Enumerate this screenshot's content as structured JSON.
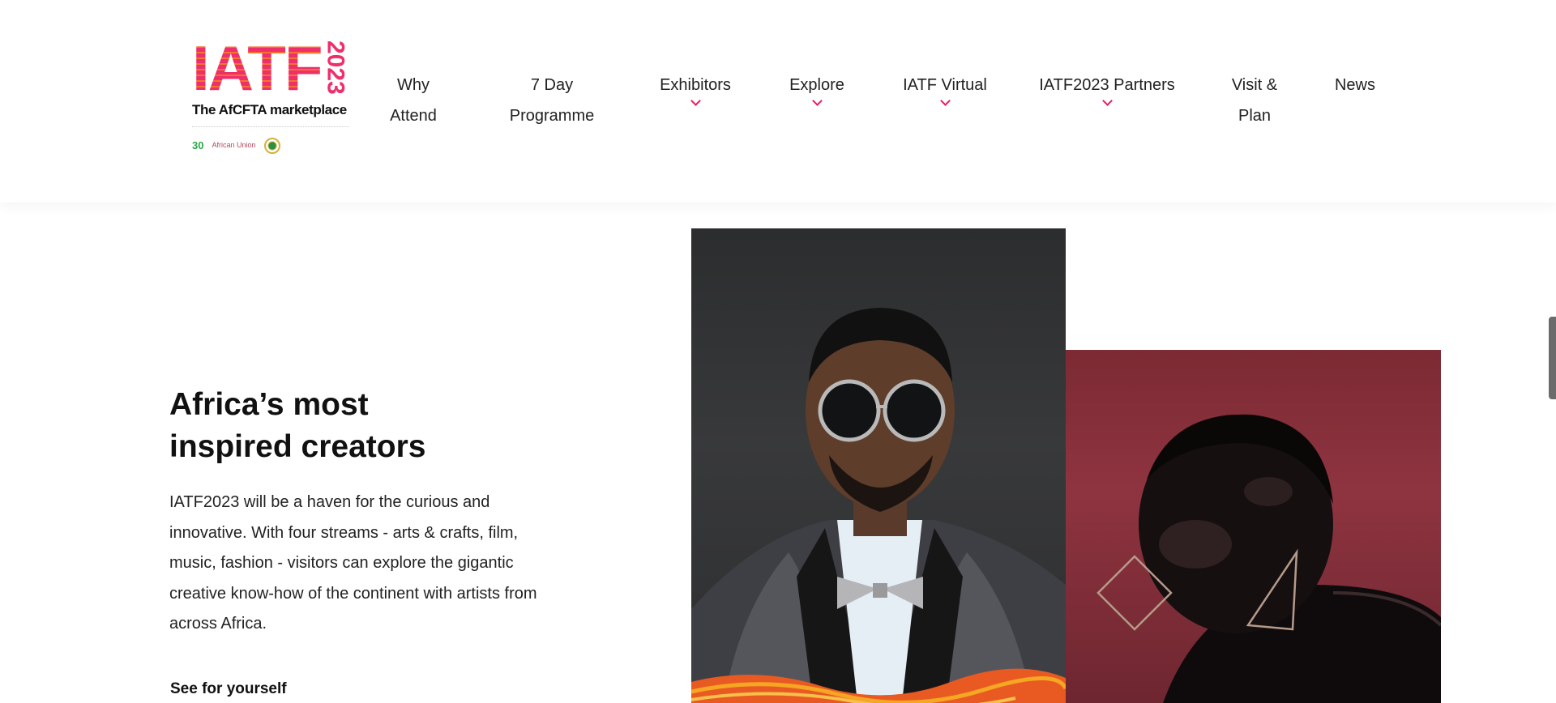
{
  "logo": {
    "main_text": "IATF",
    "year": "2023",
    "tagline": "The AfCFTA marketplace",
    "partners": [
      "30",
      "African Union",
      "seal"
    ]
  },
  "nav": {
    "items": [
      {
        "label": "Why\nAttend"
      },
      {
        "label": "7 Day\nProgramme"
      },
      {
        "label": "Exhibitors"
      },
      {
        "label": "Explore"
      },
      {
        "label": "IATF Virtual"
      },
      {
        "label": "IATF2023 Partners"
      },
      {
        "label": "Visit &\nPlan"
      },
      {
        "label": "News"
      }
    ]
  },
  "hero": {
    "title": "Africa’s most\ninspired creators",
    "body": "IATF2023 will be a haven for the curious and innovative. With four streams - arts & crafts, film, music, fashion - visitors can explore the gigantic creative know-how of the continent with artists from across Africa.",
    "link": "See for yourself"
  },
  "colors": {
    "brand_pink": "#ef2f6a",
    "brand_orange": "#f5732f",
    "chevron": "#e91e63",
    "woman_bg": "#8e3440",
    "man_bg": "#2c2d2e"
  },
  "icons": {
    "dropdown": "chevron-down-icon"
  }
}
